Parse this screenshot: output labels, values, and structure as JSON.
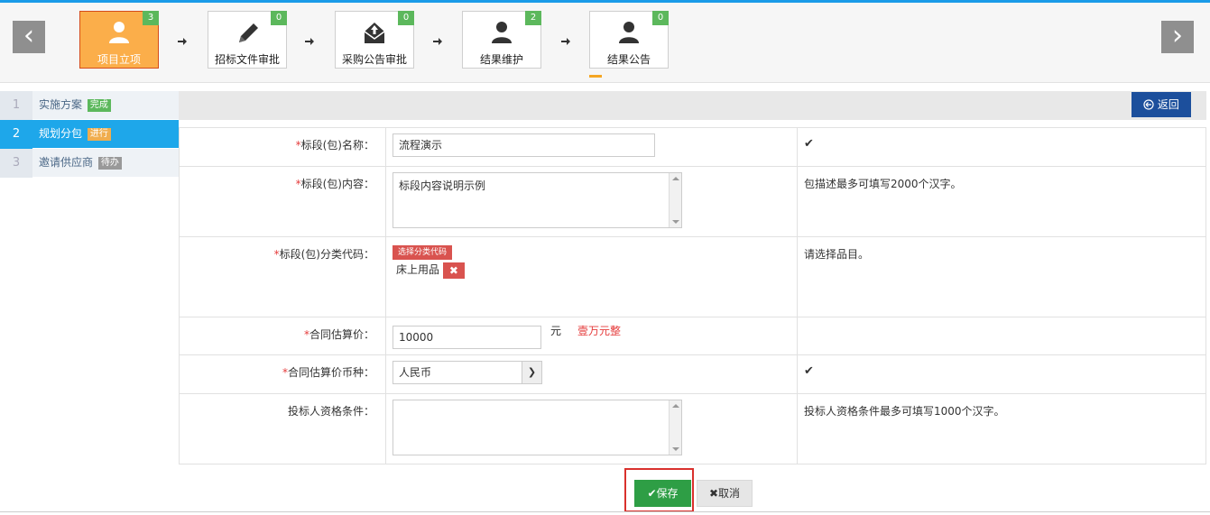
{
  "steps": [
    {
      "label": "项目立项",
      "badge": "3",
      "icon": "user-icon"
    },
    {
      "label": "招标文件审批",
      "badge": "0",
      "icon": "pencil-icon"
    },
    {
      "label": "采购公告审批",
      "badge": "0",
      "icon": "mail-upload-icon"
    },
    {
      "label": "结果维护",
      "badge": "2",
      "icon": "user-icon"
    },
    {
      "label": "结果公告",
      "badge": "0",
      "icon": "user-icon"
    }
  ],
  "sidebar": {
    "items": [
      {
        "num": "1",
        "label": "实施方案",
        "tag": "完成",
        "tag_color": "#5cb85c"
      },
      {
        "num": "2",
        "label": "规划分包",
        "tag": "进行",
        "tag_color": "#f0ad4e"
      },
      {
        "num": "3",
        "label": "邀请供应商",
        "tag": "待办",
        "tag_color": "#999999"
      }
    ]
  },
  "header": {
    "back_label": "返回"
  },
  "form": {
    "required_mark": "*",
    "name": {
      "label": "标段(包)名称：",
      "value": "流程演示",
      "hint": "✔"
    },
    "content": {
      "label": "标段(包)内容：",
      "value": "标段内容说明示例",
      "hint": "包描述最多可填写2000个汉字。"
    },
    "category": {
      "label": "标段(包)分类代码：",
      "button": "选择分类代码",
      "item": "床上用品",
      "delete": "✖",
      "hint": "请选择品目。"
    },
    "price": {
      "label": "合同估算价：",
      "value": "10000",
      "unit": "元",
      "amount_cn": "壹万元整"
    },
    "currency": {
      "label": "合同估算价币种：",
      "value": "人民币",
      "hint": "✔"
    },
    "qualification": {
      "label": "投标人资格条件：",
      "value": "",
      "hint": "投标人资格条件最多可填写1000个汉字。"
    }
  },
  "actions": {
    "save": "✔保存",
    "cancel": "✖取消"
  }
}
